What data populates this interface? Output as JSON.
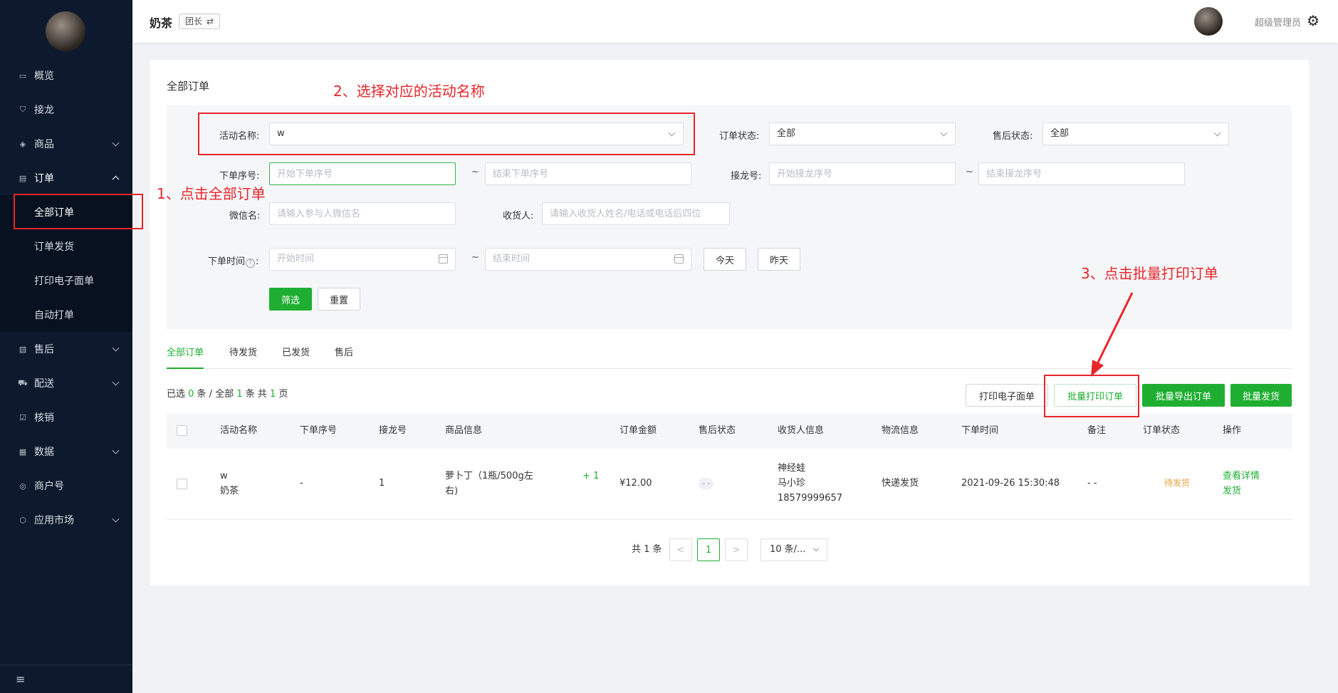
{
  "sidebar": {
    "items": [
      {
        "label": "概览",
        "icon": "monitor-icon"
      },
      {
        "label": "接龙",
        "icon": "cart-icon"
      },
      {
        "label": "商品",
        "icon": "box-icon"
      },
      {
        "label": "订单",
        "icon": "order-icon"
      },
      {
        "label": "售后",
        "icon": "aftersale-icon"
      },
      {
        "label": "配送",
        "icon": "truck-icon"
      },
      {
        "label": "核销",
        "icon": "check-icon"
      },
      {
        "label": "数据",
        "icon": "chart-icon"
      },
      {
        "label": "商户号",
        "icon": "merchant-icon"
      },
      {
        "label": "应用市场",
        "icon": "app-icon"
      }
    ],
    "order_sub": [
      "全部订单",
      "订单发货",
      "打印电子面单",
      "自动打单"
    ],
    "collapse_icon": "≡"
  },
  "header": {
    "shop_name": "奶茶",
    "role": "团长",
    "switch_icon": "⇄",
    "user_name": "超级管理员",
    "settings_icon": "⚙"
  },
  "page": {
    "title": "全部订单"
  },
  "filters": {
    "activity_label": "活动名称:",
    "activity_value": "w",
    "order_status_label": "订单状态:",
    "order_status_value": "全部",
    "aftersale_label": "售后状态:",
    "aftersale_value": "全部",
    "order_seq_label": "下单序号:",
    "order_seq_start_ph": "开始下单序号",
    "order_seq_end_ph": "结束下单序号",
    "jielong_label": "接龙号:",
    "jielong_start_ph": "开始接龙序号",
    "jielong_end_ph": "结束接龙序号",
    "wechat_label": "微信名:",
    "wechat_ph": "请输入参与人微信名",
    "receiver_label": "收货人:",
    "receiver_ph": "请输入收货人姓名/电话或电话后四位",
    "time_label": "下单时间",
    "time_help": "?",
    "time_colon": ":",
    "time_start_ph": "开始时间",
    "time_end_ph": "结束时间",
    "today": "今天",
    "yesterday": "昨天",
    "tilde": "~",
    "filter_btn": "筛选",
    "reset_btn": "重置"
  },
  "tabs": [
    "全部订单",
    "待发货",
    "已发货",
    "售后"
  ],
  "summary": {
    "p1": "已选 ",
    "selected": "0",
    "p2": " 条 / 全部 ",
    "total": "1",
    "p3": " 条 共 ",
    "pages": "1",
    "p4": " 页"
  },
  "actions": {
    "print_waybill": "打印电子面单",
    "batch_print": "批量打印订单",
    "batch_export": "批量导出订单",
    "batch_ship": "批量发货"
  },
  "table": {
    "headers": [
      "活动名称",
      "下单序号",
      "接龙号",
      "商品信息",
      "订单金额",
      "售后状态",
      "收货人信息",
      "物流信息",
      "下单时间",
      "备注",
      "订单状态",
      "操作"
    ],
    "row": {
      "activity_line1": "w",
      "activity_line2": "奶茶",
      "order_seq": "-",
      "jielong": "1",
      "product_line1": "萝卜丁（1瓶/500g左",
      "product_line2": "右)",
      "qty": "+ 1",
      "amount": "¥12.00",
      "aftersale": "- -",
      "receiver_line1": "神经蛙",
      "receiver_line2": "马小珍",
      "receiver_line3": "18579999657",
      "logistics": "快递发货",
      "time": "2021-09-26 15:30:48",
      "remark": "- -",
      "status": "待发货",
      "op_detail": "查看详情",
      "op_ship": "发货"
    }
  },
  "pagination": {
    "total_text": "共 1 条",
    "prev": "<",
    "current": "1",
    "next": ">",
    "page_size": "10 条/..."
  },
  "annotations": {
    "step1": "1、点击全部订单",
    "step2": "2、选择对应的活动名称",
    "step3": "3、点击批量打印订单",
    "color": "#e8252a"
  }
}
